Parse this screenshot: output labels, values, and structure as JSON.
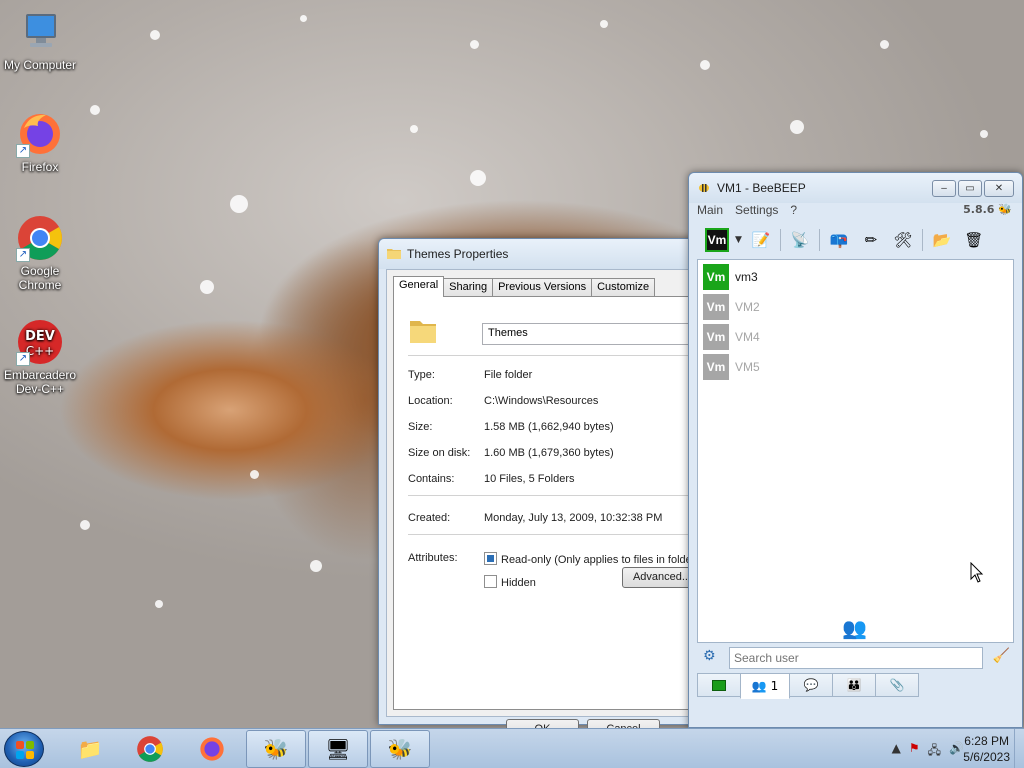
{
  "desktop": {
    "icons": [
      {
        "label": "My Computer",
        "icon": "computer-icon"
      },
      {
        "label": "Firefox",
        "icon": "firefox-icon"
      },
      {
        "label": "Google Chrome",
        "icon": "chrome-icon"
      },
      {
        "label": "Embarcadero Dev-C++",
        "icon": "devcpp-icon"
      }
    ],
    "devcpp_logo_text": "DEV C++"
  },
  "props_window": {
    "title": "Themes Properties",
    "tabs": [
      "General",
      "Sharing",
      "Previous Versions",
      "Customize"
    ],
    "active_tab": "General",
    "folder_name": "Themes",
    "fields": [
      {
        "label": "Type:",
        "value": "File folder"
      },
      {
        "label": "Location:",
        "value": "C:\\Windows\\Resources"
      },
      {
        "label": "Size:",
        "value": "1.58 MB (1,662,940 bytes)"
      },
      {
        "label": "Size on disk:",
        "value": "1.60 MB (1,679,360 bytes)"
      },
      {
        "label": "Contains:",
        "value": "10 Files, 5 Folders"
      }
    ],
    "created_label": "Created:",
    "created_value": "Monday, July 13, 2009, 10:32:38 PM",
    "attributes_label": "Attributes:",
    "readonly_label": "Read-only (Only applies to files in folder)",
    "hidden_label": "Hidden",
    "advanced_label": "Advanced...",
    "ok_label": "OK",
    "cancel_label": "Cancel"
  },
  "bee_window": {
    "title": "VM1 - BeeBEEP",
    "version": "5.8.6",
    "menu": [
      "Main",
      "Settings",
      "?"
    ],
    "status_badge": "Vm",
    "users": [
      {
        "name": "vm3",
        "online": true
      },
      {
        "name": "VM2",
        "online": false
      },
      {
        "name": "VM4",
        "online": false
      },
      {
        "name": "VM5",
        "online": false
      }
    ],
    "search_placeholder": "Search user",
    "users_tab_count": "1",
    "colors": {
      "online": "#1aa51a",
      "offline": "#a6a6a6"
    }
  },
  "taskbar": {
    "time": "6:28 PM",
    "date": "5/6/2023",
    "apps": [
      "explorer-icon",
      "chrome-icon",
      "firefox-icon",
      "beebeep-icon",
      "control-panel-icon",
      "beebeep-icon"
    ]
  }
}
